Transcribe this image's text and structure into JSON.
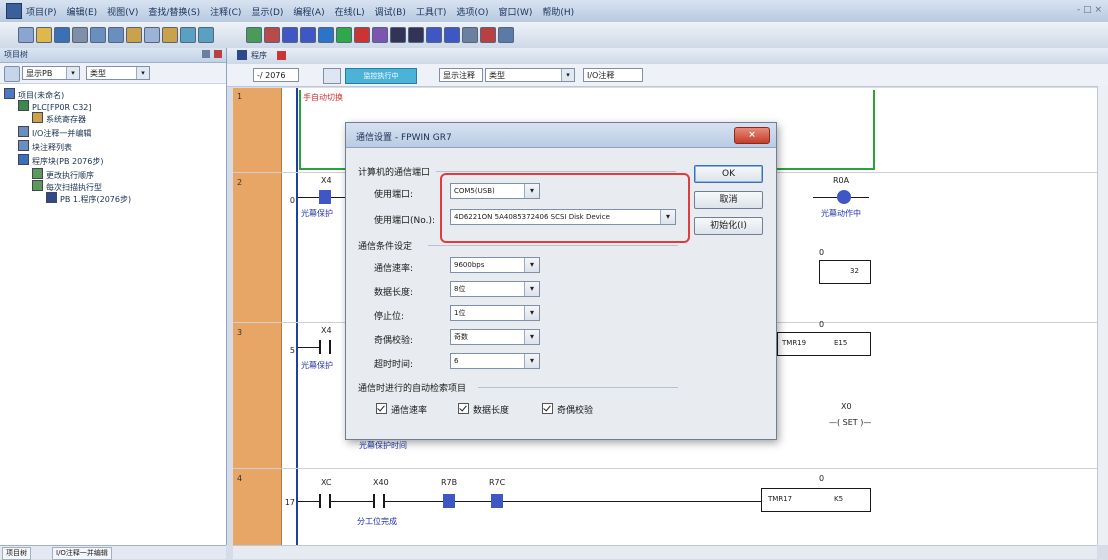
{
  "menubar": {
    "items": [
      "项目(P)",
      "编辑(E)",
      "视图(V)",
      "查找/替换(S)",
      "注释(C)",
      "显示(D)",
      "编程(A)",
      "在线(L)",
      "调试(B)",
      "工具(T)",
      "选项(O)",
      "窗口(W)",
      "帮助(H)"
    ],
    "right_text": "- □ ×"
  },
  "toolbar": {
    "icons": [
      "new-icon",
      "open-icon",
      "save-icon",
      "print-icon",
      "undo-icon",
      "redo-icon",
      "cut-icon",
      "copy-icon",
      "paste-icon",
      "find-icon",
      "replace-icon",
      "online-icon",
      "offline-icon",
      "download-icon",
      "upload-icon",
      "monitor-icon",
      "run-icon",
      "stop-icon",
      "compile-icon",
      "contact-no-icon",
      "contact-nc-icon",
      "coil-icon",
      "function-icon",
      "line-icon",
      "delete-icon",
      "zoom-icon"
    ]
  },
  "project_panel": {
    "title": "项目树",
    "toolbar_combo1": "显示PB",
    "toolbar_combo2": "类型",
    "tree": [
      {
        "label": "项目(未命名)",
        "level": 0
      },
      {
        "label": "PLC[FP0R C32]",
        "level": 1
      },
      {
        "label": "系统寄存器",
        "level": 2
      },
      {
        "label": "I/O注释一并编辑",
        "level": 1
      },
      {
        "label": "块注释列表",
        "level": 1
      },
      {
        "label": "程序块(PB 2076步)",
        "level": 1
      },
      {
        "label": "更改执行顺序",
        "level": 2
      },
      {
        "label": "每次扫描执行型",
        "level": 2
      },
      {
        "label": "PB 1.程序(2076步)",
        "level": 3
      }
    ]
  },
  "bottom_tabs": [
    "项目树",
    "I/O注释一并编辑"
  ],
  "editor": {
    "tab_title": "程序",
    "step_field": "-/ 2076",
    "mode_button": "监控执行中",
    "comment_mode": "显示注释",
    "comment_type": "类型",
    "io_comment": "I/O注释"
  },
  "ladder": {
    "rows": [
      {
        "row": "1",
        "step": "",
        "comment": "手自动切换"
      },
      {
        "row": "2",
        "step": "0",
        "contact_addr": "X4",
        "contact_label": "光幕保护",
        "coil_addr": "R0A",
        "coil_label": "光幕动作中",
        "timer_val": "0",
        "timer_out": "32"
      },
      {
        "row": "3",
        "step": "5",
        "contact_addr": "X4",
        "contact_label": "光幕保护",
        "timer_name": "TMR19",
        "timer_out": "E15",
        "timer_val": "0",
        "set_addr": "X0",
        "set_label": "SET",
        "extra_label": "光幕保护时间"
      },
      {
        "row": "4",
        "step": "17",
        "c1": "XC",
        "c2": "X40",
        "c3": "R7B",
        "c4": "R7C",
        "c2_label": "分工位完成",
        "timer_name": "TMR17",
        "timer_out": "K5",
        "timer_val": "0"
      }
    ]
  },
  "dialog": {
    "title": "通信设置 - FPWIN GR7",
    "close_label": "×",
    "group1_title": "计算机的通信端口",
    "port_label": "使用端口:",
    "port_value": "COM5(USB)",
    "port_no_label": "使用端口(No.):",
    "port_no_value": "4D6221ON 5A4085372406 SCSI Disk Device",
    "group2_title": "通信条件设定",
    "baud_label": "通信速率:",
    "baud_value": "9600bps",
    "datalen_label": "数据长度:",
    "datalen_value": "8位",
    "stopbit_label": "停止位:",
    "stopbit_value": "1位",
    "parity_label": "奇偶校验:",
    "parity_value": "奇数",
    "timeout_label": "超时时间:",
    "timeout_value": "6",
    "group3_title": "通信时进行的自动检索项目",
    "chk_baud": "通信速率",
    "chk_datalen": "数据长度",
    "chk_parity": "奇偶校验",
    "ok_label": "OK",
    "cancel_label": "取消",
    "init_label": "初始化(I)"
  },
  "colors": {
    "accent": "#3f57c5",
    "highlight": "#e23b3b",
    "row_gutter": "#e8a666"
  }
}
